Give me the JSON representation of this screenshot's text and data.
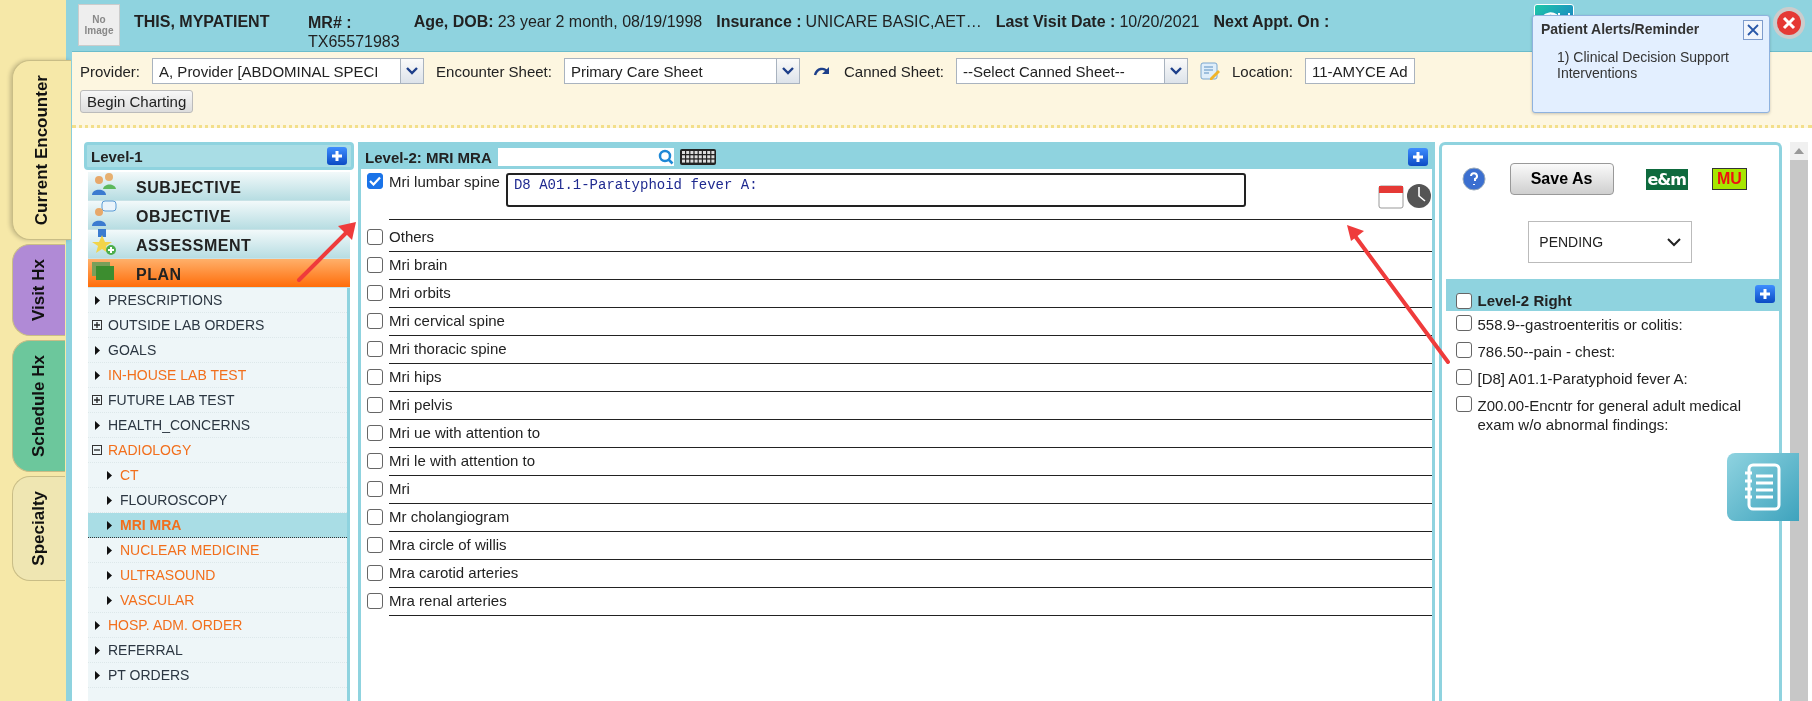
{
  "vertical_tabs": [
    {
      "label": "Current Encounter",
      "selected": true,
      "color": "#f6e8a8"
    },
    {
      "label": "Visit Hx",
      "selected": false,
      "color": "#b08ad6"
    },
    {
      "label": "Schedule Hx",
      "selected": false,
      "color": "#6cc79c"
    },
    {
      "label": "Specialty",
      "selected": false,
      "color": "#efe6b2"
    }
  ],
  "patient": {
    "photo_placeholder": "No Image",
    "name": "THIS, MYPATIENT",
    "mr_label": "MR# :",
    "mr_value": "TX65571983",
    "age_label": "Age, DOB:",
    "age_value": "23 year 2 month, 08/19/1998",
    "insurance_label": "Insurance :",
    "insurance_value": "UNICARE BASIC,AET…",
    "last_visit_label": "Last Visit Date :",
    "last_visit_value": "10/20/2021",
    "next_appt_label": "Next Appt. On :"
  },
  "toolbar": {
    "provider": {
      "label": "Provider:",
      "value": "A, Provider [ABDOMINAL SPECI"
    },
    "encounter_sheet": {
      "label": "Encounter Sheet:",
      "value": "Primary Care Sheet"
    },
    "canned_sheet": {
      "label": "Canned Sheet:",
      "value": "--Select Canned Sheet--"
    },
    "location": {
      "label": "Location:",
      "value": "11-AMYCE Ad"
    },
    "begin_button": "Begin Charting"
  },
  "alert_popup": {
    "title": "Patient Alerts/Reminder",
    "items": [
      "1) Clinical Decision Support Interventions"
    ]
  },
  "level1": {
    "title": "Level-1",
    "sections": [
      {
        "label": "SUBJECTIVE",
        "kind": "people",
        "selected": false
      },
      {
        "label": "OBJECTIVE",
        "kind": "chat",
        "selected": false
      },
      {
        "label": "ASSESSMENT",
        "kind": "star",
        "selected": false
      },
      {
        "label": "PLAN",
        "kind": "plan",
        "selected": true
      }
    ],
    "tree": [
      {
        "label": "PRESCRIPTIONS",
        "kind": "leaf",
        "highlighted": false,
        "selected": false
      },
      {
        "label": "OUTSIDE LAB ORDERS",
        "kind": "folder",
        "expanded": false,
        "highlighted": false,
        "selected": false
      },
      {
        "label": "GOALS",
        "kind": "leaf",
        "highlighted": false,
        "selected": false
      },
      {
        "label": "IN-HOUSE LAB TEST",
        "kind": "leaf",
        "highlighted": true,
        "selected": false
      },
      {
        "label": "FUTURE LAB TEST",
        "kind": "folder",
        "expanded": false,
        "highlighted": false,
        "selected": false
      },
      {
        "label": "HEALTH_CONCERNS",
        "kind": "leaf",
        "highlighted": false,
        "selected": false
      },
      {
        "label": "RADIOLOGY",
        "kind": "folder",
        "expanded": true,
        "highlighted": true,
        "selected": false,
        "children": [
          {
            "label": "CT",
            "kind": "leaf",
            "highlighted": true,
            "selected": false
          },
          {
            "label": "FLOUROSCOPY",
            "kind": "leaf",
            "highlighted": false,
            "selected": false
          },
          {
            "label": "MRI MRA",
            "kind": "leaf",
            "highlighted": true,
            "selected": true
          },
          {
            "label": "NUCLEAR MEDICINE",
            "kind": "leaf",
            "highlighted": true,
            "selected": false
          },
          {
            "label": "ULTRASOUND",
            "kind": "leaf",
            "highlighted": true,
            "selected": false
          },
          {
            "label": "VASCULAR",
            "kind": "leaf",
            "highlighted": true,
            "selected": false
          }
        ]
      },
      {
        "label": "HOSP. ADM. ORDER",
        "kind": "leaf",
        "highlighted": true,
        "selected": false
      },
      {
        "label": "REFERRAL",
        "kind": "leaf",
        "highlighted": false,
        "selected": false
      },
      {
        "label": "PT ORDERS",
        "kind": "leaf",
        "highlighted": false,
        "selected": false
      }
    ]
  },
  "level2": {
    "title": "Level-2: MRI MRA",
    "items": [
      {
        "label": "Mri lumbar spine",
        "checked": true,
        "note": "D8 A01.1-Paratyphoid fever A:"
      },
      {
        "label": "Others",
        "checked": false
      },
      {
        "label": "Mri brain",
        "checked": false
      },
      {
        "label": "Mri orbits",
        "checked": false
      },
      {
        "label": "Mri cervical spine",
        "checked": false
      },
      {
        "label": "Mri thoracic spine",
        "checked": false
      },
      {
        "label": "Mri hips",
        "checked": false
      },
      {
        "label": "Mri pelvis",
        "checked": false
      },
      {
        "label": "Mri ue with attention to",
        "checked": false
      },
      {
        "label": "Mri le with attention to",
        "checked": false
      },
      {
        "label": "Mri",
        "checked": false
      },
      {
        "label": "Mr cholangiogram",
        "checked": false
      },
      {
        "label": "Mra circle of willis",
        "checked": false
      },
      {
        "label": "Mra carotid arteries",
        "checked": false
      },
      {
        "label": "Mra renal arteries",
        "checked": false
      }
    ]
  },
  "right_panel": {
    "save_button": "Save As",
    "em_badge": "e&m",
    "mu_badge": "MU",
    "status": "PENDING",
    "level2_right": {
      "title": "Level-2 Right",
      "checked": false,
      "items": [
        {
          "label": "558.9--gastroenteritis or colitis:",
          "checked": false
        },
        {
          "label": "786.50--pain - chest:",
          "checked": false
        },
        {
          "label": "[D8] A01.1-Paratyphoid fever A:",
          "checked": false
        },
        {
          "label": "Z00.00-Encntr for general adult medical exam w/o abnormal findings:",
          "checked": false
        }
      ]
    }
  }
}
